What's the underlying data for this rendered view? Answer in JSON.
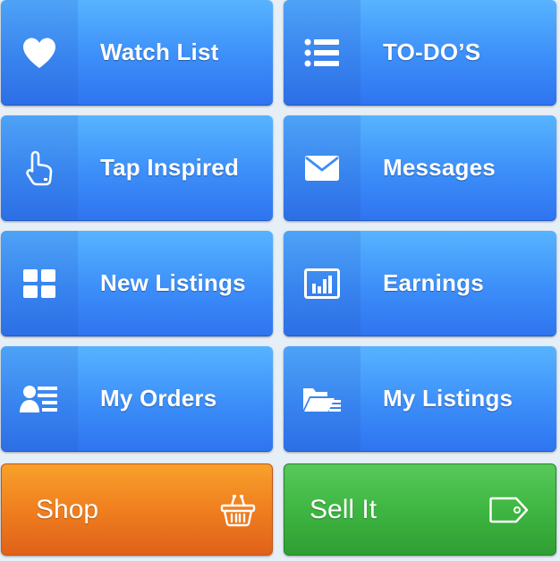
{
  "tiles": [
    {
      "label": "Watch List",
      "icon": "heart-icon"
    },
    {
      "label": "TO-DO’S",
      "icon": "list-icon"
    },
    {
      "label": "Tap Inspired",
      "icon": "hand-pointer-icon"
    },
    {
      "label": "Messages",
      "icon": "envelope-icon"
    },
    {
      "label": "New Listings",
      "icon": "grid-icon"
    },
    {
      "label": "Earnings",
      "icon": "bar-chart-icon"
    },
    {
      "label": "My Orders",
      "icon": "user-list-icon"
    },
    {
      "label": "My Listings",
      "icon": "folder-icon"
    }
  ],
  "actions": {
    "shop": {
      "label": "Shop",
      "icon": "basket-icon"
    },
    "sell": {
      "label": "Sell It",
      "icon": "tag-icon"
    }
  },
  "colors": {
    "tile_blue": "#3c8ef9",
    "shop_orange": "#f07f1f",
    "sell_green": "#3fb642"
  }
}
